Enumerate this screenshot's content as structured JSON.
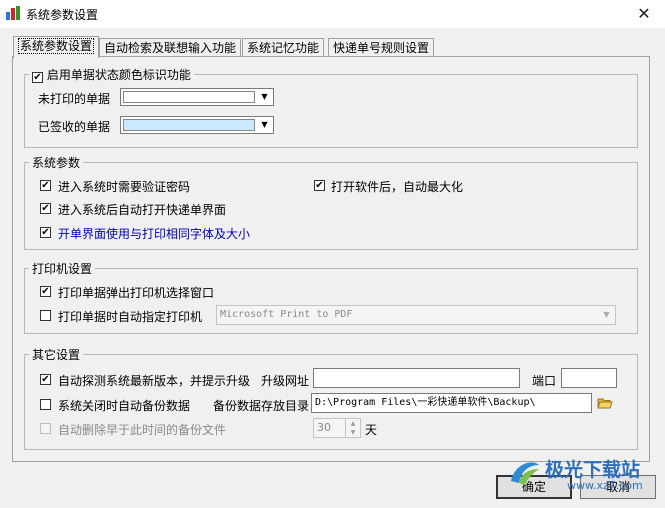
{
  "window": {
    "title": "系统参数设置",
    "close_symbol": "✕"
  },
  "tabs": [
    "系统参数设置",
    "自动检索及联想输入功能",
    "系统记忆功能",
    "快递单号规则设置"
  ],
  "status_color": {
    "label": "启用单据状态颜色标识功能",
    "checked": true,
    "unprinted_label": "未打印的单据",
    "unprinted_color": "#ffffff",
    "signed_label": "已签收的单据",
    "signed_color": "#cce8ff"
  },
  "system_params": {
    "title": "系统参数",
    "items": [
      {
        "label": "进入系统时需要验证密码",
        "checked": true
      },
      {
        "label": "打开软件后，自动最大化",
        "checked": true
      },
      {
        "label": "进入系统后自动打开快递单界面",
        "checked": true
      },
      {
        "label": "开单界面使用与打印相同字体及大小",
        "checked": true,
        "color": "#0000cc"
      }
    ]
  },
  "printer": {
    "title": "打印机设置",
    "popup_label": "打印单据弹出打印机选择窗口",
    "popup_checked": true,
    "auto_label": "打印单据时自动指定打印机",
    "auto_checked": false,
    "printer_name": "Microsoft Print to PDF"
  },
  "other": {
    "title": "其它设置",
    "update_label": "自动探测系统最新版本，并提示升级",
    "update_checked": true,
    "update_url_label": "升级网址",
    "update_url": "",
    "port_label": "端口",
    "port": "",
    "backup_label": "系统关闭时自动备份数据",
    "backup_checked": false,
    "backup_dir_label": "备份数据存放目录",
    "backup_dir": "D:\\Program Files\\一彩快递单软件\\Backup\\",
    "delete_label": "自动删除早于此时间的备份文件",
    "delete_checked": false,
    "days": "30",
    "days_unit": "天"
  },
  "buttons": {
    "ok": "确定",
    "cancel": "取消"
  },
  "watermark": {
    "brand": "极光下载站",
    "url": "www.xz7.com"
  },
  "icons": {
    "window": "app-blocks-icon",
    "folder": "folder-open-icon",
    "dropdown": "chevron-down-icon"
  }
}
